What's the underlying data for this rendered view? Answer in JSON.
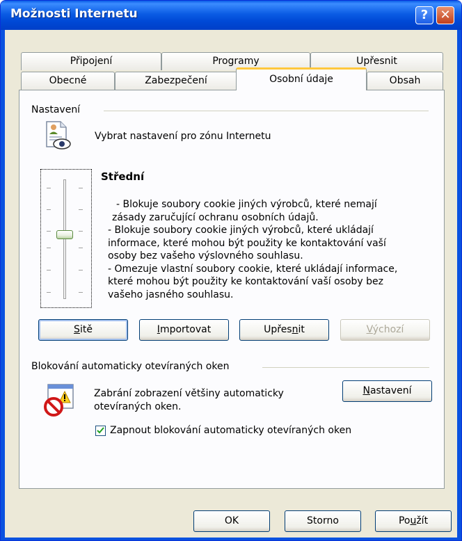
{
  "window": {
    "title": "Možnosti Internetu"
  },
  "tabs_back": [
    "Připojení",
    "Programy",
    "Upřesnit"
  ],
  "tabs_front": [
    "Obecné",
    "Zabezpečení",
    "Osobní údaje",
    "Obsah"
  ],
  "settings": {
    "group_label": "Nastavení",
    "zone_text": "Vybrat nastavení pro zónu Internetu",
    "level_title": "Střední",
    "level_fraction": 0.5,
    "description_lines": [
      "- Blokuje soubory cookie jiných výrobců, které nemají",
      "zásady zaručující ochranu osobních údajů.",
      "- Blokuje soubory cookie jiných výrobců, které ukládají",
      "informace, které mohou být použity ke kontaktování vaší",
      "osoby bez vašeho výslovného souhlasu.",
      "- Omezuje vlastní soubory cookie, které ukládají informace,",
      "které mohou být použity ke kontaktování vaší osoby bez",
      "vašeho jasného souhlasu."
    ],
    "buttons": {
      "sites": {
        "mnemonic": "S",
        "rest": "itě"
      },
      "import": {
        "mnemonic": "I",
        "rest": "mportovat"
      },
      "advanced": {
        "pre": "Upřes",
        "mnemonic": "n",
        "rest": "it"
      },
      "default": {
        "mnemonic": "V",
        "rest": "ýchozí"
      }
    }
  },
  "popup": {
    "group_label": "Blokování automaticky otevíraných oken",
    "text_line1": "Zabrání zobrazení většiny automaticky",
    "text_line2": "otevíraných oken.",
    "settings_button": {
      "mnemonic": "N",
      "rest": "astavení"
    },
    "checkbox": {
      "checked": true,
      "pre": "Zapnout ",
      "mnemonic": "b",
      "rest": "lokování automaticky otevíraných oken"
    }
  },
  "footer": {
    "ok": "OK",
    "cancel": "Storno",
    "apply": {
      "pre": "Po",
      "mnemonic": "u",
      "rest": "žít"
    }
  }
}
